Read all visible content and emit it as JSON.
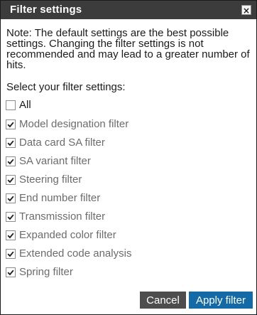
{
  "dialog": {
    "title": "Filter settings",
    "close_label": "×",
    "note": "Note: The default settings are the best possible settings. Changing the filter settings is not recommended and may lead to a greater number of hits.",
    "select_label": "Select your filter settings:"
  },
  "filters": [
    {
      "label": "All",
      "checked": false
    },
    {
      "label": "Model designation filter",
      "checked": true
    },
    {
      "label": "Data card SA filter",
      "checked": true
    },
    {
      "label": "SA variant filter",
      "checked": true
    },
    {
      "label": "Steering filter",
      "checked": true
    },
    {
      "label": "End number filter",
      "checked": true
    },
    {
      "label": "Transmission filter",
      "checked": true
    },
    {
      "label": "Expanded color filter",
      "checked": true
    },
    {
      "label": "Extended code analysis",
      "checked": true
    },
    {
      "label": "Spring filter",
      "checked": true
    }
  ],
  "buttons": {
    "cancel": "Cancel",
    "apply": "Apply filter"
  },
  "colors": {
    "titlebar": "#3c3c3c",
    "cancel": "#4d4d4d",
    "apply": "#136aa7"
  },
  "icons": {
    "close": "close-icon",
    "checkmark": "checkmark-icon"
  }
}
